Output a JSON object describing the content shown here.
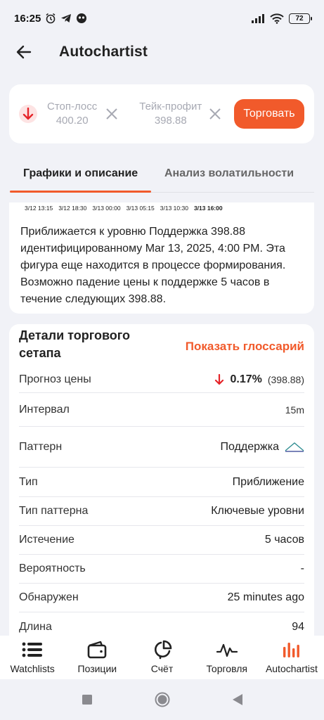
{
  "status_bar": {
    "time": "16:25",
    "battery": "72"
  },
  "header": {
    "title": "Autochartist"
  },
  "order": {
    "stop_loss_label": "Стоп-лосс",
    "stop_loss_value": "400.20",
    "take_profit_label": "Тейк-профит",
    "take_profit_value": "398.88",
    "trade_button": "Торговать"
  },
  "tabs": [
    {
      "label": "Графики и описание",
      "active": true
    },
    {
      "label": "Анализ волатильности",
      "active": false
    }
  ],
  "timeline": [
    "3/12 13:15",
    "3/12 18:30",
    "3/13 00:00",
    "3/13 05:15",
    "3/13 10:30",
    "3/13 16:00"
  ],
  "description": "Приближается к уровню Поддержка  398.88 идентифицированному Mar 13, 2025, 4:00 PM. Эта фигура еще находится в процессе формирования. Возможно падение цены к поддержке 5 часов в течение следующих 398.88.",
  "details": {
    "title": "Детали торгового сетапа",
    "glossary_link": "Показать глоссарий",
    "rows": [
      {
        "label": "Прогноз цены",
        "value": "0.17%",
        "extra": "(398.88)"
      },
      {
        "label": "Интервал",
        "value": "15m"
      },
      {
        "label": "Паттерн",
        "value": "Поддержка"
      },
      {
        "label": "Тип",
        "value": "Приближение"
      },
      {
        "label": "Тип паттерна",
        "value": "Ключевые уровни"
      },
      {
        "label": "Истечение",
        "value": "5 часов"
      },
      {
        "label": "Вероятность",
        "value": "-"
      },
      {
        "label": "Обнаружен",
        "value": "25 minutes ago"
      },
      {
        "label": "Длина",
        "value": "94"
      }
    ]
  },
  "bottom_nav": [
    {
      "label": "Watchlists",
      "icon": "list-icon"
    },
    {
      "label": "Позиции",
      "icon": "wallet-icon"
    },
    {
      "label": "Счёт",
      "icon": "pie-chart-icon"
    },
    {
      "label": "Торговля",
      "icon": "line-chart-icon"
    },
    {
      "label": "Autochartist",
      "icon": "bar-signal-icon",
      "active": true
    }
  ],
  "colors": {
    "accent": "#f15a2b",
    "down": "#e5252a",
    "background": "#f1f2f7"
  }
}
